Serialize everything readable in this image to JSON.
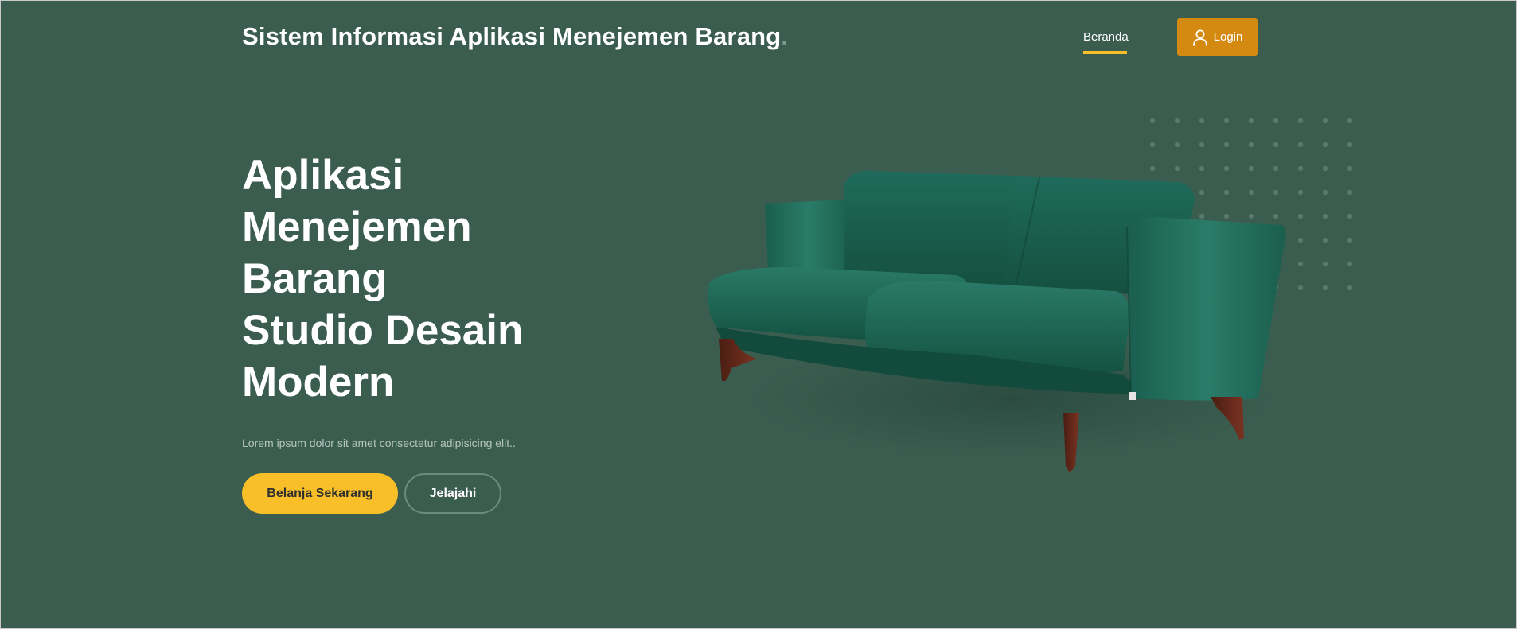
{
  "header": {
    "brand": "Sistem Informasi Aplikasi Menejemen Barang",
    "brand_dot": ".",
    "nav": {
      "home_label": "Beranda"
    },
    "login_label": "Login"
  },
  "hero": {
    "title_lines": [
      "Aplikasi",
      "Menejemen",
      "Barang",
      "Studio Desain",
      "Modern"
    ],
    "lead": "Lorem ipsum dolor sit amet consectetur adipisicing elit..",
    "primary_button": "Belanja Sekarang",
    "secondary_button": "Jelajahi",
    "image": "green-velvet-sofa"
  },
  "colors": {
    "background": "#3b5d50",
    "accent_yellow": "#f9bf29",
    "login_orange": "#d48a10"
  },
  "icons": {
    "login": "user-icon"
  }
}
